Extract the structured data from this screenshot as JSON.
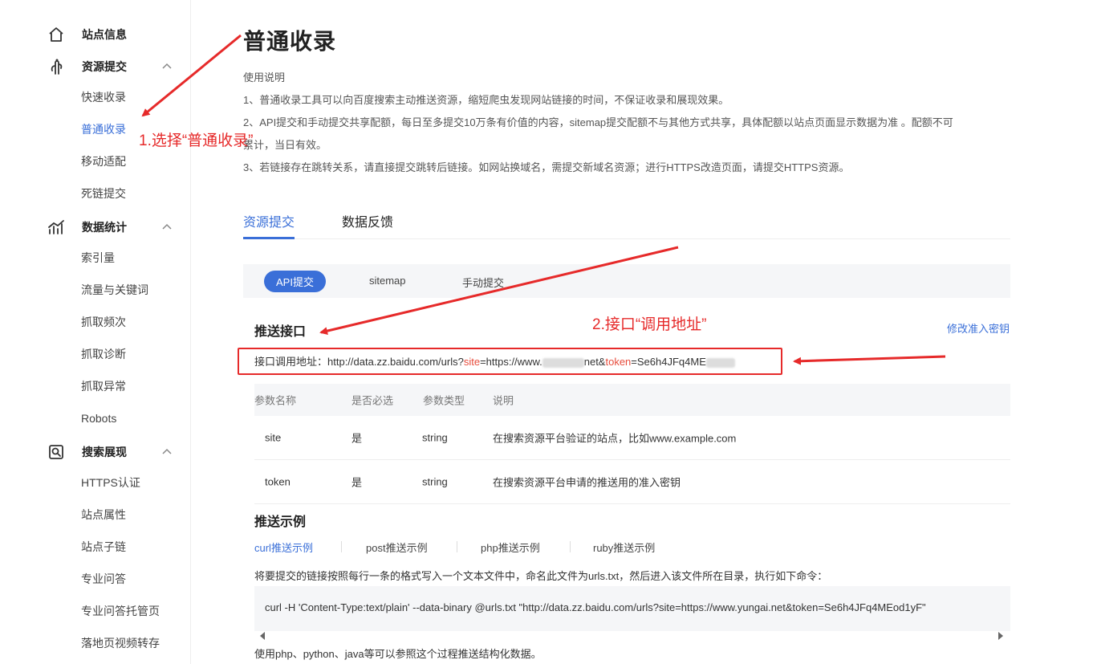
{
  "sidebar": {
    "groups": [
      {
        "label": "站点信息",
        "icon": "home-icon"
      },
      {
        "label": "资源提交",
        "icon": "hand-pointer-icon"
      },
      {
        "label": "数据统计",
        "icon": "chart-icon"
      },
      {
        "label": "搜索展现",
        "icon": "search-box-icon"
      }
    ],
    "resource_items": [
      "快速收录",
      "普通收录",
      "移动适配",
      "死链提交"
    ],
    "stats_items": [
      "索引量",
      "流量与关键词",
      "抓取频次",
      "抓取诊断",
      "抓取异常",
      "Robots"
    ],
    "search_items": [
      "HTTPS认证",
      "站点属性",
      "站点子链",
      "专业问答",
      "专业问答托管页",
      "落地页视频转存"
    ]
  },
  "main": {
    "title": "普通收录",
    "usage_heading": "使用说明",
    "notes": [
      "1、普通收录工具可以向百度搜索主动推送资源，缩短爬虫发现网站链接的时间，不保证收录和展现效果。",
      "2、API提交和手动提交共享配额，每日至多提交10万条有价值的内容，sitemap提交配额不与其他方式共享，具体配额以站点页面显示数据为准 。配额不可",
      "累计，当日有效。",
      "3、若链接存在跳转关系，请直接提交跳转后链接。如网站换域名，需提交新域名资源；进行HTTPS改造页面，请提交HTTPS资源。"
    ],
    "tabs": [
      "资源提交",
      "数据反馈"
    ],
    "subtabs": [
      "API提交",
      "sitemap",
      "手动提交"
    ],
    "push_api_title": "推送接口",
    "modify_key_link": "修改准入密钥",
    "endpoint": {
      "label": "接口调用地址：",
      "url_prefix": "http://data.zz.baidu.com/urls?",
      "site_key": "site",
      "site_value_start": "=https://www.",
      "site_value_end": "net&",
      "token_key": "token",
      "token_value": "=Se6h4JFq4ME"
    },
    "table": {
      "headers": [
        "参数名称",
        "是否必选",
        "参数类型",
        "说明"
      ],
      "rows": [
        [
          "site",
          "是",
          "string",
          "在搜索资源平台验证的站点，比如www.example.com"
        ],
        [
          "token",
          "是",
          "string",
          "在搜索资源平台申请的推送用的准入密钥"
        ]
      ]
    },
    "example_title": "推送示例",
    "example_tabs": [
      "curl推送示例",
      "post推送示例",
      "php推送示例",
      "ruby推送示例"
    ],
    "example_desc": "将要提交的链接按照每行一条的格式写入一个文本文件中，命名此文件为urls.txt，然后进入该文件所在目录，执行如下命令：",
    "example_code": "curl -H 'Content-Type:text/plain' --data-binary @urls.txt \"http://data.zz.baidu.com/urls?site=https://www.yungai.net&token=Se6h4JFq4MEod1yF\"",
    "footer_note": "使用php、python、java等可以参照这个过程推送结构化数据。"
  },
  "annotations": {
    "step1": "1.选择“普通收录”",
    "step2": "2.接口“调用地址”",
    "color": "#e62a2a"
  },
  "colors": {
    "accent": "#3a6fd8",
    "annotation": "#e62a2a",
    "panel_bg": "#f5f6f8"
  }
}
